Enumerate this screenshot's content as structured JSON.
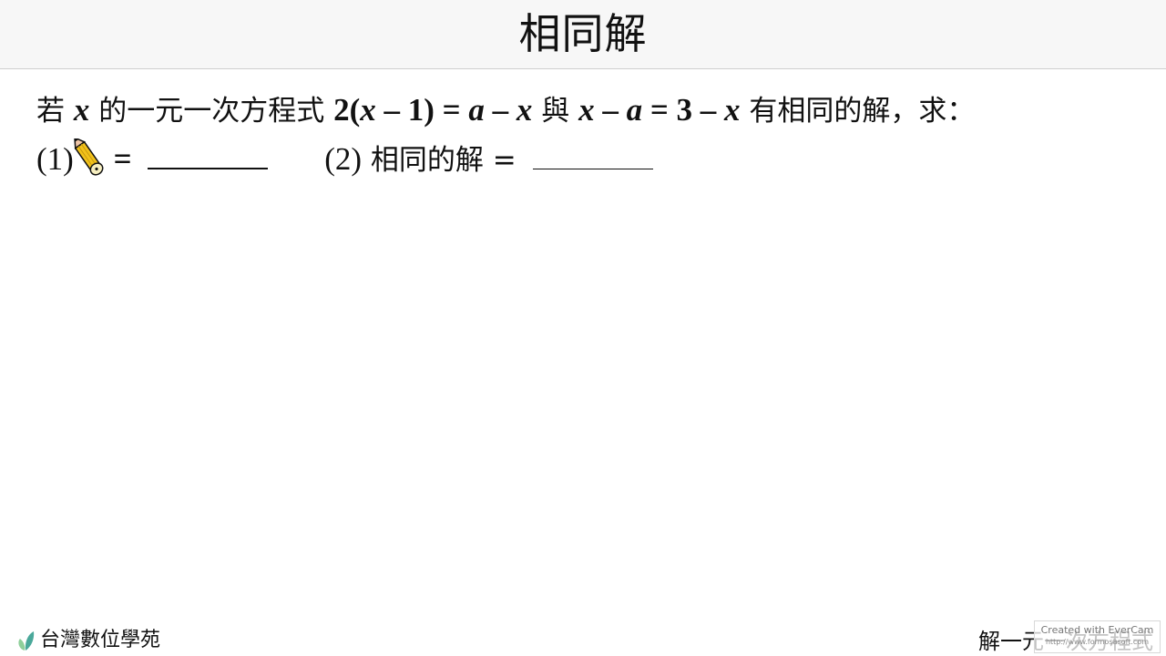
{
  "header": {
    "title": "相同解"
  },
  "question": {
    "intro": "若",
    "var_x": "x",
    "text1": "的一元一次方程式",
    "eq1_left": "2(",
    "eq1_x": "x",
    "eq1_mid": " – 1) = ",
    "eq1_a": "a",
    "eq1_minus": " – ",
    "eq1_x2": "x",
    "conj": "與",
    "eq2_x": "x",
    "eq2_minus": " – ",
    "eq2_a": "a",
    "eq2_rest": " = 3 – ",
    "eq2_x2": "x",
    "text2": "有相同的解，求："
  },
  "parts": {
    "p1_label": "(1)",
    "p1_eq": "=",
    "p2_label": "(2)",
    "p2_text": "相同的解 =",
    "p1_answer": "",
    "p2_answer": ""
  },
  "footer": {
    "brand": "台灣數位學苑",
    "chapter": "解一元一次方程式"
  },
  "watermark": {
    "line1": "Created with EverCam",
    "line2": "http://www.formosasoft.com"
  },
  "colors": {
    "leaf_left": "#8fcf9a",
    "leaf_right": "#4aa89a",
    "pencil_body": "#f2c21b"
  }
}
